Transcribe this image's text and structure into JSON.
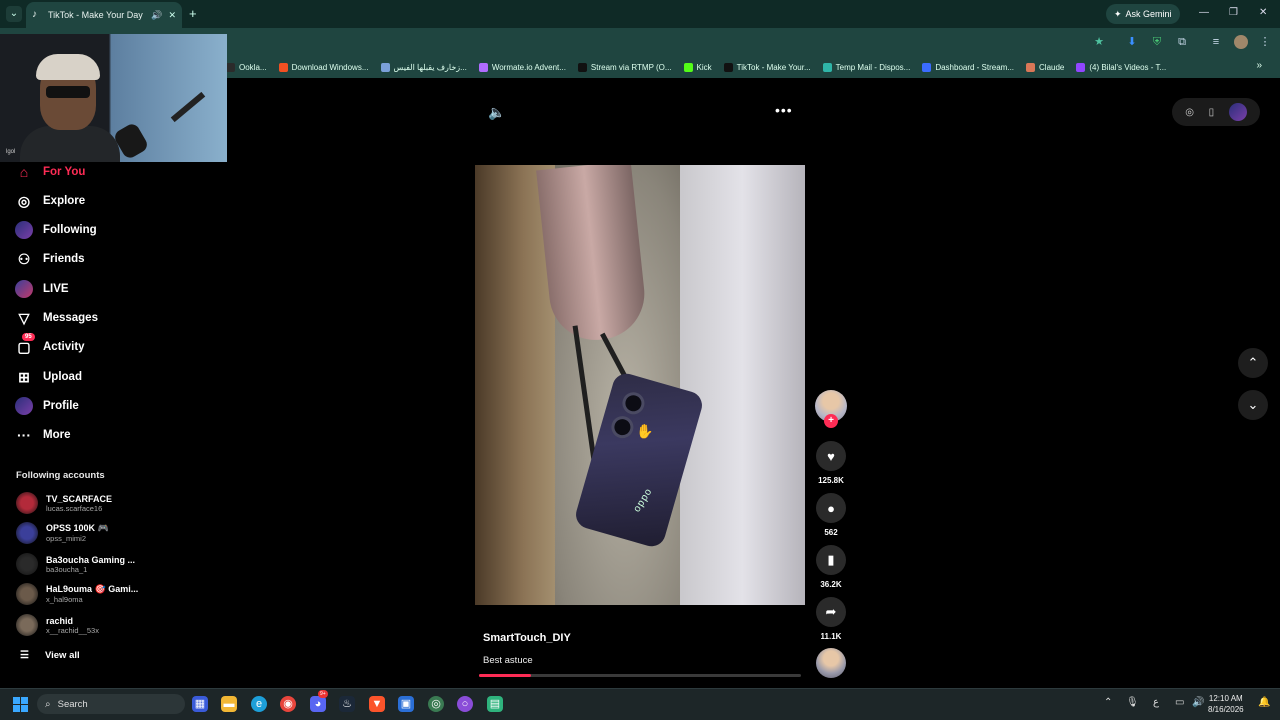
{
  "browser": {
    "tab_title": "TikTok - Make Your Day",
    "ask_gemini": "Ask Gemini",
    "bookmarks": [
      {
        "label": "Ookla...",
        "color": "#2b2b2b"
      },
      {
        "label": "Download Windows...",
        "color": "#f25022"
      },
      {
        "label": "زخارف يقبلها الفيس...",
        "color": "#7aa0d8"
      },
      {
        "label": "Wormate.io Advent...",
        "color": "#b06cff"
      },
      {
        "label": "Stream via RTMP (O...",
        "color": "#111111"
      },
      {
        "label": "Kick",
        "color": "#53fc18"
      },
      {
        "label": "TikTok - Make Your...",
        "color": "#111111"
      },
      {
        "label": "Temp Mail - Dispos...",
        "color": "#2fb5a8"
      },
      {
        "label": "Dashboard - Stream...",
        "color": "#3b6cff"
      },
      {
        "label": "Claude",
        "color": "#d97757"
      },
      {
        "label": "(4) Bilal's Videos - T...",
        "color": "#9146ff"
      }
    ]
  },
  "webcam": {
    "tag": "lgol"
  },
  "sidebar": {
    "nav": [
      {
        "label": "For You",
        "icon": "home-icon"
      },
      {
        "label": "Explore",
        "icon": "compass-icon"
      },
      {
        "label": "Following",
        "icon": "following-avatar-icon"
      },
      {
        "label": "Friends",
        "icon": "friends-icon"
      },
      {
        "label": "LIVE",
        "icon": "live-icon"
      },
      {
        "label": "Messages",
        "icon": "messages-icon"
      },
      {
        "label": "Activity",
        "icon": "activity-icon",
        "badge": "95"
      },
      {
        "label": "Upload",
        "icon": "upload-icon"
      },
      {
        "label": "Profile",
        "icon": "profile-avatar-icon"
      },
      {
        "label": "More",
        "icon": "more-icon"
      }
    ],
    "following_header": "Following accounts",
    "accounts": [
      {
        "name": "TV_SCARFACE",
        "handle": "lucas.scarface16",
        "color": "#b32a3a"
      },
      {
        "name": "OPSS 100K 🎮",
        "handle": "opss_mimi2",
        "color": "#3b3f9a"
      },
      {
        "name": "Ba3oucha Gaming ...",
        "handle": "ba3oucha_1",
        "color": "#2a2a2a"
      },
      {
        "name": "HaL9ouma 🎯 Gami...",
        "handle": "x_hal9oma",
        "color": "#6b5a4a"
      },
      {
        "name": "rachid",
        "handle": "x__rachid__53x",
        "color": "#7a6a5a"
      }
    ],
    "view_all": "View all"
  },
  "video": {
    "author": "SmartTouch_DIY",
    "description": "Best astuce",
    "phone_brand": "oppo",
    "progress": 0.16,
    "likes": "125.8K",
    "comments": "562",
    "saves": "36.2K",
    "shares": "11.1K"
  },
  "taskbar": {
    "search": "Search",
    "lang": "ع",
    "time": "12:10 AM",
    "date": "8/16/2026",
    "discord_badge": "9+"
  },
  "colors": {
    "accent": "#fe2c55",
    "chrome": "#1f4540"
  }
}
